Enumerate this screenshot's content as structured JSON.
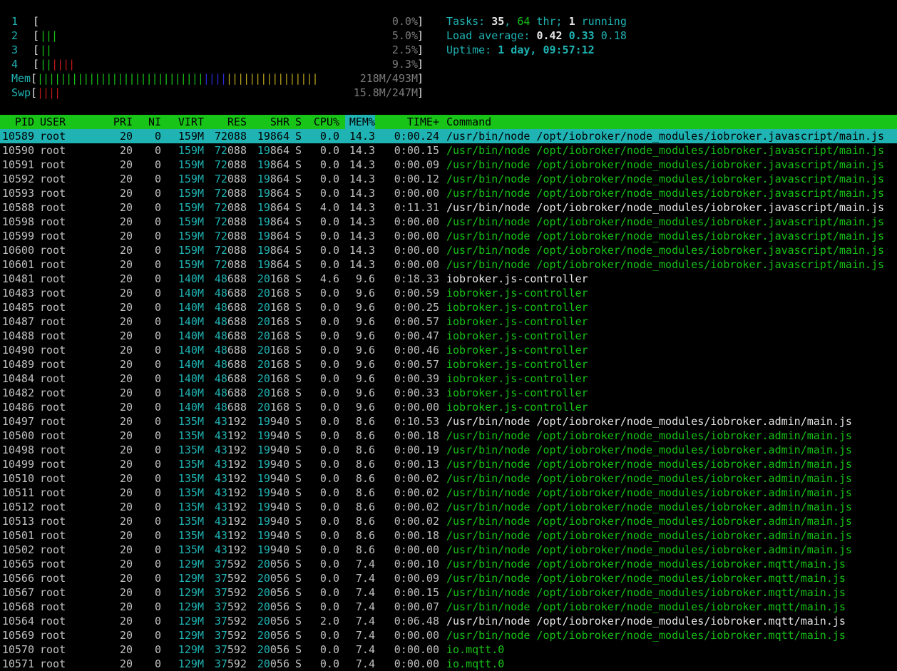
{
  "meters": {
    "cpu": [
      {
        "label": "1",
        "value_text": "0.0%",
        "percent": 0.0,
        "bars": []
      },
      {
        "label": "2",
        "value_text": "5.0%",
        "percent": 5.0,
        "bars": [
          {
            "c": "g",
            "n": 3
          }
        ]
      },
      {
        "label": "3",
        "value_text": "2.5%",
        "percent": 2.5,
        "bars": [
          {
            "c": "g",
            "n": 2
          }
        ]
      },
      {
        "label": "4",
        "value_text": "9.3%",
        "percent": 9.3,
        "bars": [
          {
            "c": "g",
            "n": 2
          },
          {
            "c": "r",
            "n": 4
          }
        ]
      }
    ],
    "mem": {
      "label": "Mem",
      "value_text": "218M/493M",
      "bars": [
        {
          "c": "g",
          "n": 29
        },
        {
          "c": "b",
          "n": 4
        },
        {
          "c": "y",
          "n": 16
        }
      ]
    },
    "swp": {
      "label": "Swp",
      "value_text": "15.8M/247M",
      "bars": [
        {
          "c": "r",
          "n": 4
        }
      ]
    }
  },
  "sysinfo": {
    "tasks_label": "Tasks: ",
    "tasks": "35",
    "sep1": ", ",
    "threads": "64",
    "thr_label": " thr; ",
    "running": "1",
    "running_label": " running",
    "load_label": "Load average: ",
    "load1": "0.42",
    "load5": "0.33",
    "load15": "0.18",
    "uptime_label": "Uptime: ",
    "uptime": "1 day, 09:57:12"
  },
  "header": {
    "pid": "PID",
    "user": "USER",
    "pri": "PRI",
    "ni": "NI",
    "virt": "VIRT",
    "res": "RES",
    "shr": "SHR",
    "s": "S",
    "cpu": "CPU%",
    "mem": "MEM%",
    "time": "TIME+",
    "cmd": "Command"
  },
  "processes": [
    {
      "pid": "10589",
      "user": "root",
      "pri": "20",
      "ni": "0",
      "virt": "159M",
      "res": "72088",
      "shr": "19864",
      "s": "S",
      "cpu": "0.0",
      "mem": "14.3",
      "time": "0:00.24",
      "cmd": "/usr/bin/node /opt/iobroker/node_modules/iobroker.javascript/main.js",
      "thread": false,
      "selected": true
    },
    {
      "pid": "10590",
      "user": "root",
      "pri": "20",
      "ni": "0",
      "virt": "159M",
      "res": "72088",
      "shr": "19864",
      "s": "S",
      "cpu": "0.0",
      "mem": "14.3",
      "time": "0:00.15",
      "cmd": "/usr/bin/node /opt/iobroker/node_modules/iobroker.javascript/main.js",
      "thread": true
    },
    {
      "pid": "10591",
      "user": "root",
      "pri": "20",
      "ni": "0",
      "virt": "159M",
      "res": "72088",
      "shr": "19864",
      "s": "S",
      "cpu": "0.0",
      "mem": "14.3",
      "time": "0:00.09",
      "cmd": "/usr/bin/node /opt/iobroker/node_modules/iobroker.javascript/main.js",
      "thread": true
    },
    {
      "pid": "10592",
      "user": "root",
      "pri": "20",
      "ni": "0",
      "virt": "159M",
      "res": "72088",
      "shr": "19864",
      "s": "S",
      "cpu": "0.0",
      "mem": "14.3",
      "time": "0:00.12",
      "cmd": "/usr/bin/node /opt/iobroker/node_modules/iobroker.javascript/main.js",
      "thread": true
    },
    {
      "pid": "10593",
      "user": "root",
      "pri": "20",
      "ni": "0",
      "virt": "159M",
      "res": "72088",
      "shr": "19864",
      "s": "S",
      "cpu": "0.0",
      "mem": "14.3",
      "time": "0:00.00",
      "cmd": "/usr/bin/node /opt/iobroker/node_modules/iobroker.javascript/main.js",
      "thread": true
    },
    {
      "pid": "10588",
      "user": "root",
      "pri": "20",
      "ni": "0",
      "virt": "159M",
      "res": "72088",
      "shr": "19864",
      "s": "S",
      "cpu": "4.0",
      "mem": "14.3",
      "time": "0:11.31",
      "cmd": "/usr/bin/node /opt/iobroker/node_modules/iobroker.javascript/main.js",
      "thread": false
    },
    {
      "pid": "10598",
      "user": "root",
      "pri": "20",
      "ni": "0",
      "virt": "159M",
      "res": "72088",
      "shr": "19864",
      "s": "S",
      "cpu": "0.0",
      "mem": "14.3",
      "time": "0:00.00",
      "cmd": "/usr/bin/node /opt/iobroker/node_modules/iobroker.javascript/main.js",
      "thread": true
    },
    {
      "pid": "10599",
      "user": "root",
      "pri": "20",
      "ni": "0",
      "virt": "159M",
      "res": "72088",
      "shr": "19864",
      "s": "S",
      "cpu": "0.0",
      "mem": "14.3",
      "time": "0:00.00",
      "cmd": "/usr/bin/node /opt/iobroker/node_modules/iobroker.javascript/main.js",
      "thread": true
    },
    {
      "pid": "10600",
      "user": "root",
      "pri": "20",
      "ni": "0",
      "virt": "159M",
      "res": "72088",
      "shr": "19864",
      "s": "S",
      "cpu": "0.0",
      "mem": "14.3",
      "time": "0:00.00",
      "cmd": "/usr/bin/node /opt/iobroker/node_modules/iobroker.javascript/main.js",
      "thread": true
    },
    {
      "pid": "10601",
      "user": "root",
      "pri": "20",
      "ni": "0",
      "virt": "159M",
      "res": "72088",
      "shr": "19864",
      "s": "S",
      "cpu": "0.0",
      "mem": "14.3",
      "time": "0:00.00",
      "cmd": "/usr/bin/node /opt/iobroker/node_modules/iobroker.javascript/main.js",
      "thread": true
    },
    {
      "pid": "10481",
      "user": "root",
      "pri": "20",
      "ni": "0",
      "virt": "140M",
      "res": "48688",
      "shr": "20168",
      "s": "S",
      "cpu": "4.6",
      "mem": "9.6",
      "time": "0:18.33",
      "cmd": "iobroker.js-controller",
      "thread": false
    },
    {
      "pid": "10483",
      "user": "root",
      "pri": "20",
      "ni": "0",
      "virt": "140M",
      "res": "48688",
      "shr": "20168",
      "s": "S",
      "cpu": "0.0",
      "mem": "9.6",
      "time": "0:00.59",
      "cmd": "iobroker.js-controller",
      "thread": true
    },
    {
      "pid": "10485",
      "user": "root",
      "pri": "20",
      "ni": "0",
      "virt": "140M",
      "res": "48688",
      "shr": "20168",
      "s": "S",
      "cpu": "0.0",
      "mem": "9.6",
      "time": "0:00.25",
      "cmd": "iobroker.js-controller",
      "thread": true
    },
    {
      "pid": "10487",
      "user": "root",
      "pri": "20",
      "ni": "0",
      "virt": "140M",
      "res": "48688",
      "shr": "20168",
      "s": "S",
      "cpu": "0.0",
      "mem": "9.6",
      "time": "0:00.57",
      "cmd": "iobroker.js-controller",
      "thread": true
    },
    {
      "pid": "10488",
      "user": "root",
      "pri": "20",
      "ni": "0",
      "virt": "140M",
      "res": "48688",
      "shr": "20168",
      "s": "S",
      "cpu": "0.0",
      "mem": "9.6",
      "time": "0:00.47",
      "cmd": "iobroker.js-controller",
      "thread": true
    },
    {
      "pid": "10490",
      "user": "root",
      "pri": "20",
      "ni": "0",
      "virt": "140M",
      "res": "48688",
      "shr": "20168",
      "s": "S",
      "cpu": "0.0",
      "mem": "9.6",
      "time": "0:00.46",
      "cmd": "iobroker.js-controller",
      "thread": true
    },
    {
      "pid": "10489",
      "user": "root",
      "pri": "20",
      "ni": "0",
      "virt": "140M",
      "res": "48688",
      "shr": "20168",
      "s": "S",
      "cpu": "0.0",
      "mem": "9.6",
      "time": "0:00.57",
      "cmd": "iobroker.js-controller",
      "thread": true
    },
    {
      "pid": "10484",
      "user": "root",
      "pri": "20",
      "ni": "0",
      "virt": "140M",
      "res": "48688",
      "shr": "20168",
      "s": "S",
      "cpu": "0.0",
      "mem": "9.6",
      "time": "0:00.39",
      "cmd": "iobroker.js-controller",
      "thread": true
    },
    {
      "pid": "10482",
      "user": "root",
      "pri": "20",
      "ni": "0",
      "virt": "140M",
      "res": "48688",
      "shr": "20168",
      "s": "S",
      "cpu": "0.0",
      "mem": "9.6",
      "time": "0:00.33",
      "cmd": "iobroker.js-controller",
      "thread": true
    },
    {
      "pid": "10486",
      "user": "root",
      "pri": "20",
      "ni": "0",
      "virt": "140M",
      "res": "48688",
      "shr": "20168",
      "s": "S",
      "cpu": "0.0",
      "mem": "9.6",
      "time": "0:00.00",
      "cmd": "iobroker.js-controller",
      "thread": true
    },
    {
      "pid": "10497",
      "user": "root",
      "pri": "20",
      "ni": "0",
      "virt": "135M",
      "res": "43192",
      "shr": "19940",
      "s": "S",
      "cpu": "0.0",
      "mem": "8.6",
      "time": "0:10.53",
      "cmd": "/usr/bin/node /opt/iobroker/node_modules/iobroker.admin/main.js",
      "thread": false
    },
    {
      "pid": "10500",
      "user": "root",
      "pri": "20",
      "ni": "0",
      "virt": "135M",
      "res": "43192",
      "shr": "19940",
      "s": "S",
      "cpu": "0.0",
      "mem": "8.6",
      "time": "0:00.18",
      "cmd": "/usr/bin/node /opt/iobroker/node_modules/iobroker.admin/main.js",
      "thread": true
    },
    {
      "pid": "10498",
      "user": "root",
      "pri": "20",
      "ni": "0",
      "virt": "135M",
      "res": "43192",
      "shr": "19940",
      "s": "S",
      "cpu": "0.0",
      "mem": "8.6",
      "time": "0:00.19",
      "cmd": "/usr/bin/node /opt/iobroker/node_modules/iobroker.admin/main.js",
      "thread": true
    },
    {
      "pid": "10499",
      "user": "root",
      "pri": "20",
      "ni": "0",
      "virt": "135M",
      "res": "43192",
      "shr": "19940",
      "s": "S",
      "cpu": "0.0",
      "mem": "8.6",
      "time": "0:00.13",
      "cmd": "/usr/bin/node /opt/iobroker/node_modules/iobroker.admin/main.js",
      "thread": true
    },
    {
      "pid": "10510",
      "user": "root",
      "pri": "20",
      "ni": "0",
      "virt": "135M",
      "res": "43192",
      "shr": "19940",
      "s": "S",
      "cpu": "0.0",
      "mem": "8.6",
      "time": "0:00.02",
      "cmd": "/usr/bin/node /opt/iobroker/node_modules/iobroker.admin/main.js",
      "thread": true
    },
    {
      "pid": "10511",
      "user": "root",
      "pri": "20",
      "ni": "0",
      "virt": "135M",
      "res": "43192",
      "shr": "19940",
      "s": "S",
      "cpu": "0.0",
      "mem": "8.6",
      "time": "0:00.02",
      "cmd": "/usr/bin/node /opt/iobroker/node_modules/iobroker.admin/main.js",
      "thread": true
    },
    {
      "pid": "10512",
      "user": "root",
      "pri": "20",
      "ni": "0",
      "virt": "135M",
      "res": "43192",
      "shr": "19940",
      "s": "S",
      "cpu": "0.0",
      "mem": "8.6",
      "time": "0:00.02",
      "cmd": "/usr/bin/node /opt/iobroker/node_modules/iobroker.admin/main.js",
      "thread": true
    },
    {
      "pid": "10513",
      "user": "root",
      "pri": "20",
      "ni": "0",
      "virt": "135M",
      "res": "43192",
      "shr": "19940",
      "s": "S",
      "cpu": "0.0",
      "mem": "8.6",
      "time": "0:00.02",
      "cmd": "/usr/bin/node /opt/iobroker/node_modules/iobroker.admin/main.js",
      "thread": true
    },
    {
      "pid": "10501",
      "user": "root",
      "pri": "20",
      "ni": "0",
      "virt": "135M",
      "res": "43192",
      "shr": "19940",
      "s": "S",
      "cpu": "0.0",
      "mem": "8.6",
      "time": "0:00.18",
      "cmd": "/usr/bin/node /opt/iobroker/node_modules/iobroker.admin/main.js",
      "thread": true
    },
    {
      "pid": "10502",
      "user": "root",
      "pri": "20",
      "ni": "0",
      "virt": "135M",
      "res": "43192",
      "shr": "19940",
      "s": "S",
      "cpu": "0.0",
      "mem": "8.6",
      "time": "0:00.00",
      "cmd": "/usr/bin/node /opt/iobroker/node_modules/iobroker.admin/main.js",
      "thread": true
    },
    {
      "pid": "10565",
      "user": "root",
      "pri": "20",
      "ni": "0",
      "virt": "129M",
      "res": "37592",
      "shr": "20056",
      "s": "S",
      "cpu": "0.0",
      "mem": "7.4",
      "time": "0:00.10",
      "cmd": "/usr/bin/node /opt/iobroker/node_modules/iobroker.mqtt/main.js",
      "thread": true
    },
    {
      "pid": "10566",
      "user": "root",
      "pri": "20",
      "ni": "0",
      "virt": "129M",
      "res": "37592",
      "shr": "20056",
      "s": "S",
      "cpu": "0.0",
      "mem": "7.4",
      "time": "0:00.09",
      "cmd": "/usr/bin/node /opt/iobroker/node_modules/iobroker.mqtt/main.js",
      "thread": true
    },
    {
      "pid": "10567",
      "user": "root",
      "pri": "20",
      "ni": "0",
      "virt": "129M",
      "res": "37592",
      "shr": "20056",
      "s": "S",
      "cpu": "0.0",
      "mem": "7.4",
      "time": "0:00.15",
      "cmd": "/usr/bin/node /opt/iobroker/node_modules/iobroker.mqtt/main.js",
      "thread": true
    },
    {
      "pid": "10568",
      "user": "root",
      "pri": "20",
      "ni": "0",
      "virt": "129M",
      "res": "37592",
      "shr": "20056",
      "s": "S",
      "cpu": "0.0",
      "mem": "7.4",
      "time": "0:00.07",
      "cmd": "/usr/bin/node /opt/iobroker/node_modules/iobroker.mqtt/main.js",
      "thread": true
    },
    {
      "pid": "10564",
      "user": "root",
      "pri": "20",
      "ni": "0",
      "virt": "129M",
      "res": "37592",
      "shr": "20056",
      "s": "S",
      "cpu": "2.0",
      "mem": "7.4",
      "time": "0:06.48",
      "cmd": "/usr/bin/node /opt/iobroker/node_modules/iobroker.mqtt/main.js",
      "thread": false
    },
    {
      "pid": "10569",
      "user": "root",
      "pri": "20",
      "ni": "0",
      "virt": "129M",
      "res": "37592",
      "shr": "20056",
      "s": "S",
      "cpu": "0.0",
      "mem": "7.4",
      "time": "0:00.00",
      "cmd": "/usr/bin/node /opt/iobroker/node_modules/iobroker.mqtt/main.js",
      "thread": true
    },
    {
      "pid": "10570",
      "user": "root",
      "pri": "20",
      "ni": "0",
      "virt": "129M",
      "res": "37592",
      "shr": "20056",
      "s": "S",
      "cpu": "0.0",
      "mem": "7.4",
      "time": "0:00.00",
      "cmd": "io.mqtt.0",
      "thread": true
    },
    {
      "pid": "10571",
      "user": "root",
      "pri": "20",
      "ni": "0",
      "virt": "129M",
      "res": "37592",
      "shr": "20056",
      "s": "S",
      "cpu": "0.0",
      "mem": "7.4",
      "time": "0:00.00",
      "cmd": "io.mqtt.0",
      "thread": true
    }
  ]
}
